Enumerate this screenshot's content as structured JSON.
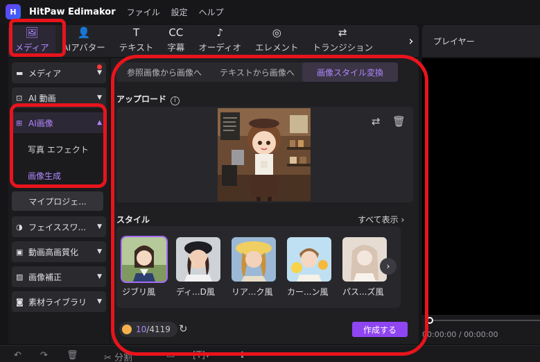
{
  "app": {
    "title": "HitPaw Edimakor",
    "logo_text": "H"
  },
  "menu": [
    "ファイル",
    "設定",
    "ヘルプ"
  ],
  "toolbar": {
    "tools": [
      {
        "label": "メディア",
        "icon": "🖼",
        "active": true
      },
      {
        "label": "AIアバター",
        "icon": "👤",
        "active": false
      },
      {
        "label": "テキスト",
        "icon": "T",
        "active": false
      },
      {
        "label": "字幕",
        "icon": "CC",
        "active": false
      },
      {
        "label": "オーディオ",
        "icon": "♪",
        "active": false
      },
      {
        "label": "エレメント",
        "icon": "◎",
        "active": false
      },
      {
        "label": "トランジション",
        "icon": "⇄",
        "active": false
      }
    ],
    "next_icon": "›"
  },
  "player": {
    "title": "プレイヤー",
    "timecode": "00:00:00 / 00:00:00"
  },
  "sidebar": {
    "items": [
      {
        "label": "メディア",
        "icon": "▬"
      },
      {
        "label": "AI 動画",
        "icon": "⊡"
      },
      {
        "label": "AI画像",
        "icon": "⊞"
      },
      {
        "label": "フェイススワ...",
        "icon": "◑"
      },
      {
        "label": "動画高画質化",
        "icon": "▣"
      },
      {
        "label": "画像補正",
        "icon": "▨"
      },
      {
        "label": "素材ライブラリ",
        "icon": "◙"
      }
    ],
    "sub_items": [
      "写真 エフェクト",
      "画像生成"
    ],
    "project_button": "マイプロジェ..."
  },
  "main": {
    "tabs": [
      "参照画像から画像へ",
      "テキストから画像へ",
      "画像スタイル変換"
    ],
    "upload_title": "アップロード",
    "info_icon": "i",
    "style_title": "スタイル",
    "see_all": "すべて表示",
    "see_all_icon": "›",
    "styles": [
      {
        "label": "ジブリ風"
      },
      {
        "label": "ディ...D風"
      },
      {
        "label": "リア...ク風"
      },
      {
        "label": "カー...ン風"
      },
      {
        "label": "パス...ズ風"
      }
    ],
    "credits_used": "10",
    "credits_total": "/4119",
    "create_button": "作成する"
  },
  "bottom_toolbar": {
    "split_label": "分割"
  },
  "colors": {
    "accent": "#b187ff",
    "primary_button": "#8f45f1",
    "annotation": "#e8141c"
  }
}
